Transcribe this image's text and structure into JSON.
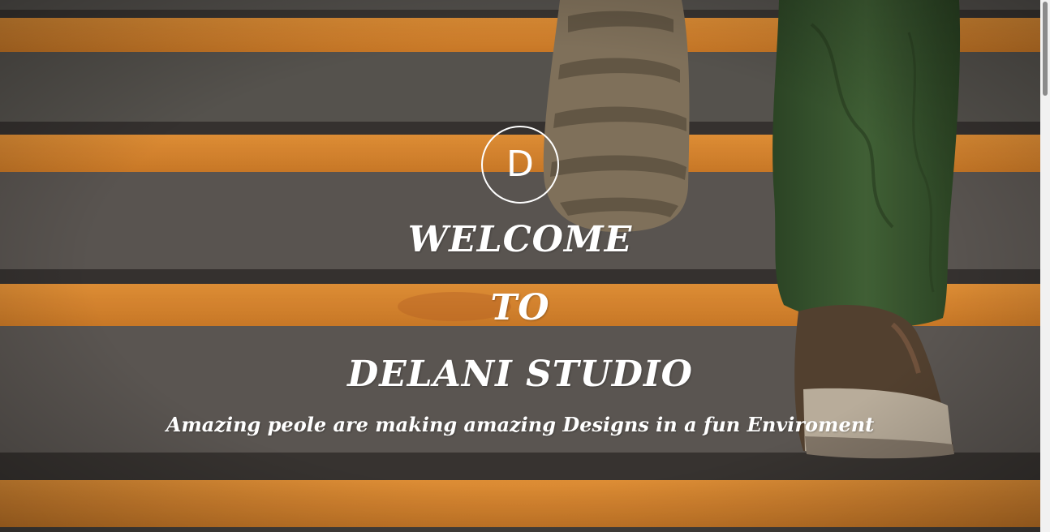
{
  "hero": {
    "logo_letter": "D",
    "headline_line1": "WELCOME",
    "headline_line2": "TO",
    "headline_line3": "DELANI STUDIO",
    "tagline": "Amazing peole are making amazing Designs in a fun Enviroment",
    "background_image": "photo of a person in green trousers and brown sneakers walking up grey concrete stairs with orange edge stripes",
    "colors": {
      "text": "#ffffff",
      "stair_stripe": "#e8902f",
      "stair_concrete": "#5f5b56",
      "trousers": "#3a5a30",
      "shoe": "#5a4a3a"
    }
  },
  "scrollbar": {
    "present": true
  }
}
